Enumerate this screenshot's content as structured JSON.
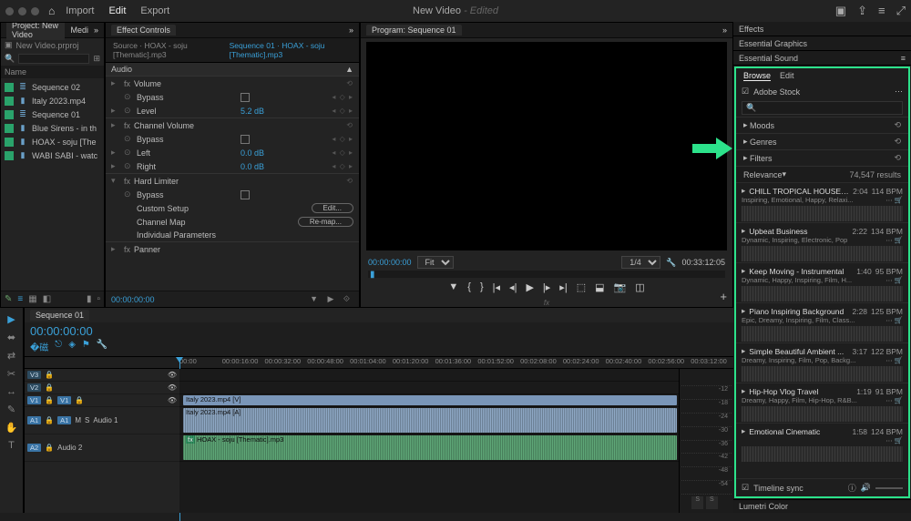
{
  "title": {
    "main": "New Video",
    "suffix": "Edited"
  },
  "topmenu": [
    "Import",
    "Edit",
    "Export"
  ],
  "project": {
    "header": "Project: New Video",
    "media": "Medi",
    "file": "New Video.prproj",
    "name_col": "Name",
    "items": [
      {
        "icon": "≡",
        "label": "Sequence 02"
      },
      {
        "icon": "▮",
        "label": "Italy 2023.mp4"
      },
      {
        "icon": "≡",
        "label": "Sequence 01"
      },
      {
        "icon": "▮",
        "label": "Blue Sirens - in th"
      },
      {
        "icon": "▮",
        "label": "HOAX - soju [The"
      },
      {
        "icon": "▮",
        "label": "WABI SABI - watc"
      }
    ]
  },
  "fx": {
    "panel": "Effect Controls",
    "src": "Source · HOAX - soju [Thematic].mp3",
    "seq": "Sequence 01 · HOAX - soju [Thematic].mp3",
    "audio": "Audio",
    "rows": [
      {
        "type": "head",
        "label": "Volume"
      },
      {
        "type": "bypass",
        "label": "Bypass"
      },
      {
        "type": "val",
        "label": "Level",
        "val": "5.2 dB"
      },
      {
        "type": "head",
        "label": "Channel Volume"
      },
      {
        "type": "bypass",
        "label": "Bypass"
      },
      {
        "type": "val",
        "label": "Left",
        "val": "0.0 dB"
      },
      {
        "type": "val",
        "label": "Right",
        "val": "0.0 dB"
      },
      {
        "type": "head",
        "label": "Hard Limiter"
      },
      {
        "type": "bypass",
        "label": "Bypass"
      },
      {
        "type": "btn",
        "label": "Custom Setup",
        "btn": "Edit..."
      },
      {
        "type": "btn",
        "label": "Channel Map",
        "btn": "Re-map..."
      },
      {
        "type": "plain",
        "label": "Individual Parameters"
      },
      {
        "type": "head",
        "label": "Panner"
      }
    ],
    "tc": "00:00:00:00"
  },
  "program": {
    "tab": "Program: Sequence 01",
    "tc_in": "00:00:00:00",
    "fit": "Fit",
    "scale": "1/4",
    "tc_out": "00:33:12:05"
  },
  "right": {
    "effects": "Effects",
    "eg": "Essential Graphics",
    "es": "Essential Sound",
    "browse": "Browse",
    "edit": "Edit",
    "stock": "Adobe Stock",
    "search_ph": "🔍",
    "facets": [
      "Moods",
      "Genres",
      "Filters"
    ],
    "sort": "Relevance",
    "results": "74,547 results",
    "tracks": [
      {
        "t": "CHILL TROPICAL HOUSE (...",
        "d": "2:04",
        "b": "114 BPM",
        "s": "Inspiring, Emotional, Happy, Relaxi..."
      },
      {
        "t": "Upbeat Business",
        "d": "2:22",
        "b": "134 BPM",
        "s": "Dynamic, Inspiring, Electronic, Pop"
      },
      {
        "t": "Keep Moving - Instrumental",
        "d": "1:40",
        "b": "95 BPM",
        "s": "Dynamic, Happy, Inspiring, Film, H..."
      },
      {
        "t": "Piano Inspiring Background",
        "d": "2:28",
        "b": "125 BPM",
        "s": "Epic, Dreamy, Inspiring, Film, Class..."
      },
      {
        "t": "Simple Beautiful Ambient ...",
        "d": "3:17",
        "b": "122 BPM",
        "s": "Dreamy, Inspiring, Film, Pop, Backg..."
      },
      {
        "t": "Hip-Hop Vlog Travel",
        "d": "1:19",
        "b": "91 BPM",
        "s": "Dreamy, Happy, Film, Hip-Hop, R&B..."
      },
      {
        "t": "Emotional Cinematic",
        "d": "1:58",
        "b": "124 BPM",
        "s": ""
      }
    ],
    "sync": "Timeline sync",
    "lumetri": "Lumetri Color"
  },
  "timeline": {
    "tab": "Sequence 01",
    "tc": "00:00:00:00",
    "ruler": [
      "00:00",
      "00:00:16:00",
      "00:00:32:00",
      "00:00:48:00",
      "00:01:04:00",
      "00:01:20:00",
      "00:01:36:00",
      "00:01:52:00",
      "00:02:08:00",
      "00:02:24:00",
      "00:02:40:00",
      "00:02:56:00",
      "00:03:12:00"
    ],
    "vlabels": [
      "V3",
      "V2",
      "V1"
    ],
    "a1": "Audio 1",
    "a2": "Audio 2",
    "clip_v": "Italy 2023.mp4 [V]",
    "clip_a": "Italy 2023.mp4 [A]",
    "clip_a2": "HOAX - soju [Thematic].mp3",
    "meters": [
      "-12",
      "-18",
      "-24",
      "-30",
      "-36",
      "-42",
      "-48",
      "-54"
    ],
    "s": "S"
  }
}
